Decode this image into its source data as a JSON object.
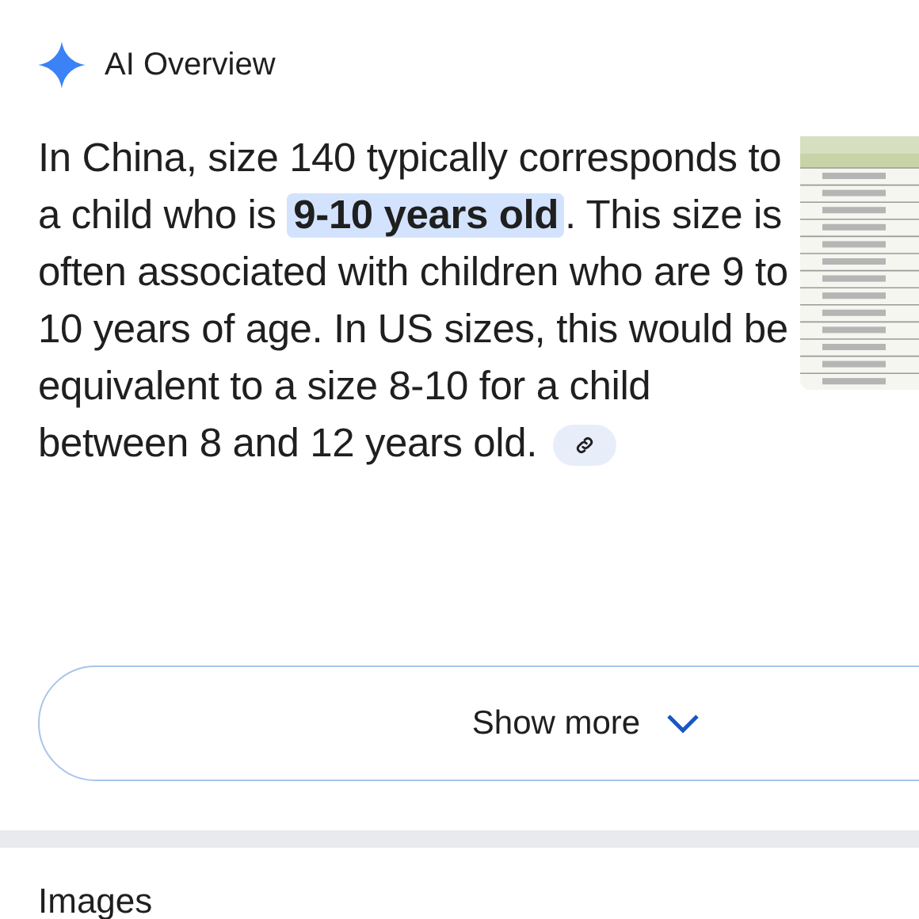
{
  "header": {
    "title": "AI Overview"
  },
  "answer": {
    "segments": [
      {
        "text": "In China, size 140 typically corresponds to a child who is ",
        "highlighted": false
      },
      {
        "text": "9-10 years old",
        "highlighted": true
      },
      {
        "text": ". This size is often associated with children who are 9 to 10 years of age. In US sizes, this would be equivalent to a size 8-10 for a child between 8 and 12 years old.",
        "highlighted": false
      }
    ]
  },
  "show_more": {
    "label": "Show more"
  },
  "images_section": {
    "title": "Images"
  }
}
